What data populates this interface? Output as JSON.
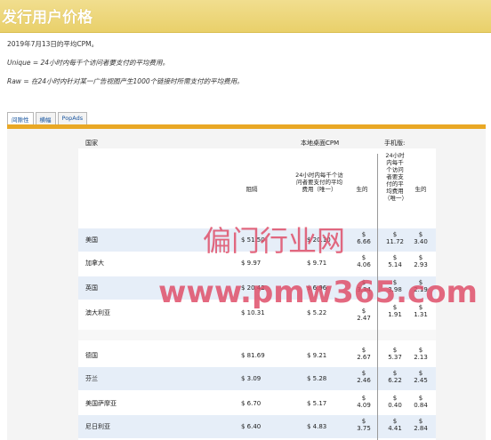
{
  "page_title": "发行用户价格",
  "intro": {
    "line1": "2019年7月13日的平均CPM。",
    "line2": "Unique = 24小时内每千个访问者要支付的平均费用。",
    "line3": "Raw = 在24小时内针对某一广告视图产生1000个链接时所需支付的平均费用。"
  },
  "tabs": [
    "间隙性",
    "横幅",
    "PopAds"
  ],
  "table": {
    "header_country": "国家",
    "header_desktop": "本地桌面CPM",
    "header_mobile": "手机版:",
    "col_all": "阻隔",
    "col_unique": "24小时内每千个访问者要支付的平均费用（唯一）",
    "col_raw": "生的",
    "col_mobile_unique": "24小时内每千个访问者要支付的平均费用（唯一）",
    "col_mobile_raw": "生的",
    "rows": [
      {
        "country": "美国",
        "all": "$ 51.50",
        "unique": "$ 20.10",
        "raw": "$ 6.66",
        "m_unique": "$ 11.72",
        "m_raw": "$ 3.40"
      },
      {
        "country": "加拿大",
        "all": "$ 9.97",
        "unique": "$ 9.71",
        "raw": "$ 4.06",
        "m_unique": "$ 5.14",
        "m_raw": "$ 2.93"
      },
      {
        "country": "英国",
        "all": "$ 20.42",
        "unique": "$ 6.96",
        "raw": "$ 3.34",
        "m_unique": "$ 3.98",
        "m_raw": "$ 2.19"
      },
      {
        "country": "澳大利亚",
        "all": "$ 10.31",
        "unique": "$ 5.22",
        "raw": "$ 2.47",
        "m_unique": "$ 1.91",
        "m_raw": "$ 1.31"
      },
      {
        "country": "德国",
        "all": "$ 81.69",
        "unique": "$ 9.21",
        "raw": "$ 2.67",
        "m_unique": "$ 5.37",
        "m_raw": "$ 2.13"
      },
      {
        "country": "芬兰",
        "all": "$ 3.09",
        "unique": "$ 5.28",
        "raw": "$ 2.46",
        "m_unique": "$ 6.22",
        "m_raw": "$ 2.45"
      },
      {
        "country": "美国萨摩亚",
        "all": "$ 6.70",
        "unique": "$ 5.17",
        "raw": "$ 4.09",
        "m_unique": "$ 0.40",
        "m_raw": "$ 0.84"
      },
      {
        "country": "尼日利亚",
        "all": "$ 6.40",
        "unique": "$ 4.83",
        "raw": "$ 3.75",
        "m_unique": "$ 4.41",
        "m_raw": "$ 2.84"
      }
    ]
  },
  "watermark": {
    "line1": "偏门行业网",
    "line2": "www.pmw365.com"
  },
  "colors": {
    "header_bg": "#ecd474",
    "accent_bar": "#e9a825",
    "row_band": "#e6eef8",
    "watermark": "#e0506a"
  }
}
